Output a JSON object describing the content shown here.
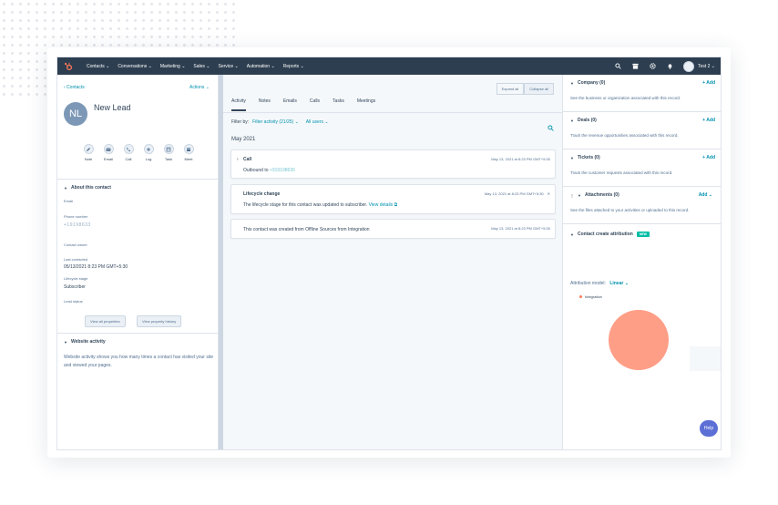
{
  "nav": {
    "items": [
      "Contacts ⌄",
      "Conversations ⌄",
      "Marketing ⌄",
      "Sales ⌄",
      "Service ⌄",
      "Automation ⌄",
      "Reports ⌄"
    ],
    "account_label": "Test 2 ⌄"
  },
  "left": {
    "back_link": "‹ Contacts",
    "actions_label": "Actions ⌄",
    "avatar_initials": "NL",
    "contact_name": "New Lead",
    "quick_actions": [
      "Note",
      "Email",
      "Call",
      "Log",
      "Task",
      "Meet"
    ],
    "about_title": "About this contact",
    "properties": {
      "email_label": "Email",
      "phone_label": "Phone number",
      "phone_value": "+19198633",
      "owner_label": "Contact owner",
      "last_contacted_label": "Last contacted",
      "last_contacted_value": "05/13/2021 8:23 PM GMT+5:30",
      "lifecycle_label": "Lifecycle stage",
      "lifecycle_value": "Subscriber",
      "lead_status_label": "Lead status"
    },
    "view_all_properties": "View all properties",
    "view_property_history": "View property history",
    "website_title": "Website activity",
    "website_text": "Website activity shows you how many times a contact has visited your site and viewed your pages."
  },
  "mid": {
    "expand_all": "Expand all",
    "collapse_all": "Collapse all",
    "tabs": [
      "Activity",
      "Notes",
      "Emails",
      "Calls",
      "Tasks",
      "Meetings"
    ],
    "filter_label": "Filter by:",
    "filter_activity": "Filter activity (21/25) ⌄",
    "all_users": "All users ⌄",
    "month": "May 2021",
    "activities": {
      "call_title": "Call",
      "call_date": "May 13, 2021 at 8:23 PM GMT+5:30",
      "call_body": "Outbound to",
      "call_number": "+919198636",
      "lifecycle_title": "Lifecycle change",
      "lifecycle_date": "May 13, 2021 at 8:23 PM GMT+5:30",
      "lifecycle_body": "The lifecycle stage for this contact was updated to subscriber.",
      "lifecycle_link": "View details",
      "created_body": "This contact was created from Offline Sources from Integration",
      "created_date": "May 13, 2021 at 8:23 PM GMT+5:30"
    }
  },
  "right": {
    "company_title": "Company (0)",
    "company_text": "See the business or organization associated with this record.",
    "deals_title": "Deals (0)",
    "deals_text": "Track the revenue opportunities associated with this record.",
    "tickets_title": "Tickets (0)",
    "tickets_text": "Track the customer requests associated with this record.",
    "attachments_title": "Attachments (0)",
    "attachments_text": "See the files attached to your activities or uploaded to this record.",
    "add_label": "+ Add",
    "add_dropdown_label": "Add ⌄",
    "attribution_title": "Contact create attribution",
    "new_badge": "NEW",
    "attribution_model_label": "Attribution model:",
    "attribution_model_value": "Linear ⌄",
    "legend_label": "Integration",
    "help_label": "Help"
  },
  "colors": {
    "nav_bg": "#2d3e50",
    "link": "#0091ae",
    "pie": "#ff9e86",
    "legend_dot": "#ff7a59",
    "help": "#5c6fd5",
    "badge": "#00bda5"
  }
}
